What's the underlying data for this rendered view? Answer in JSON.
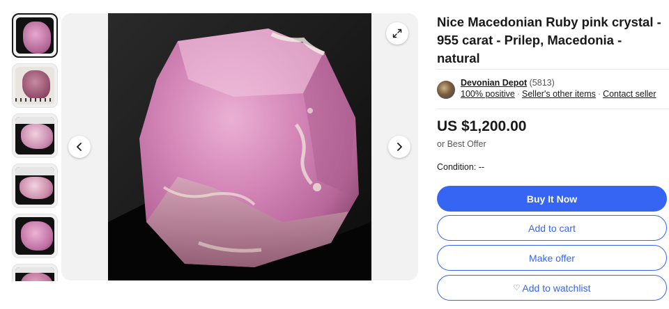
{
  "gallery": {
    "thumbnails": [
      {
        "label": "thumbnail-1",
        "selected": true
      },
      {
        "label": "thumbnail-2",
        "selected": false
      },
      {
        "label": "thumbnail-3",
        "selected": false
      },
      {
        "label": "thumbnail-4",
        "selected": false
      },
      {
        "label": "thumbnail-5",
        "selected": false
      },
      {
        "label": "thumbnail-6",
        "selected": false
      }
    ],
    "prev_icon": "chevron-left-icon",
    "next_icon": "chevron-right-icon",
    "expand_icon": "expand-icon"
  },
  "listing": {
    "title": "Nice Macedonian Ruby pink crystal - 955 carat - Prilep, Macedonia - natural",
    "seller": {
      "name": "Devonian Depot",
      "feedback_count": "(5813)",
      "positive": "100% positive",
      "other_items": "Seller's other items",
      "contact": "Contact seller"
    },
    "price": "US $1,200.00",
    "best_offer": "or Best Offer",
    "condition": "Condition:  --"
  },
  "actions": {
    "buy_now": "Buy It Now",
    "add_to_cart": "Add to cart",
    "make_offer": "Make offer",
    "watchlist": "Add to watchlist",
    "watchlist_icon": "heart-icon"
  },
  "colors": {
    "primary": "#3665f3",
    "text": "#191919",
    "stone_pink": "#d48ab8"
  }
}
